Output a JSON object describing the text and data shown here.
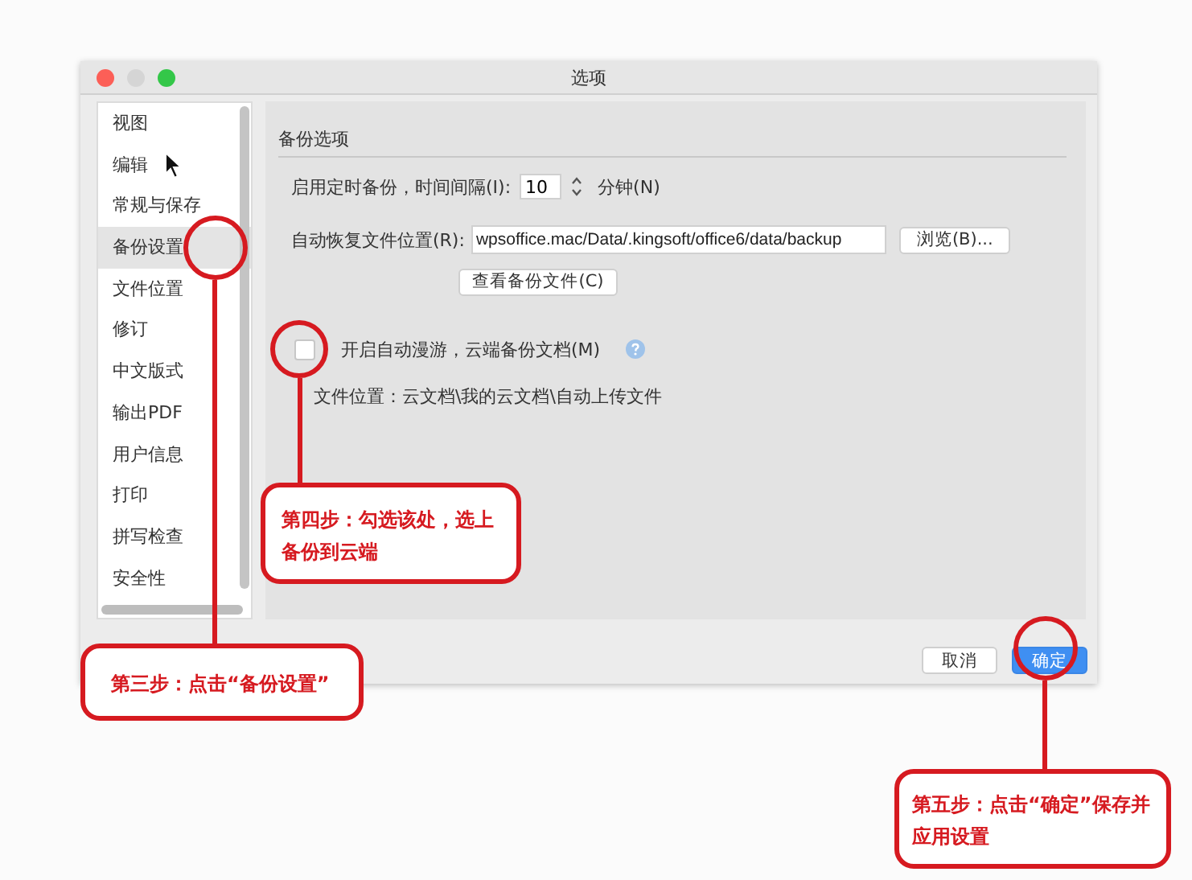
{
  "window": {
    "title": "选项"
  },
  "sidebar": {
    "items": [
      {
        "label": "视图",
        "selected": false
      },
      {
        "label": "编辑",
        "selected": false
      },
      {
        "label": "常规与保存",
        "selected": false
      },
      {
        "label": "备份设置",
        "selected": true
      },
      {
        "label": "文件位置",
        "selected": false
      },
      {
        "label": "修订",
        "selected": false
      },
      {
        "label": "中文版式",
        "selected": false
      },
      {
        "label": "输出PDF",
        "selected": false
      },
      {
        "label": "用户信息",
        "selected": false
      },
      {
        "label": "打印",
        "selected": false
      },
      {
        "label": "拼写检查",
        "selected": false
      },
      {
        "label": "安全性",
        "selected": false
      }
    ]
  },
  "panel": {
    "section_title": "备份选项",
    "timer": {
      "label": "启用定时备份，时间间隔(I):",
      "value": "10",
      "unit": "分钟(N)"
    },
    "recovery": {
      "label": "自动恢复文件位置(R):",
      "value": "wpsoffice.mac/Data/.kingsoft/office6/data/backup",
      "browse_button": "浏览(B)..."
    },
    "view_button": "查看备份文件(C)",
    "roaming": {
      "label": "开启自动漫游，云端备份文档(M)",
      "checked": false
    },
    "location": "文件位置：云文档\\我的云文档\\自动上传文件"
  },
  "buttons": [
    {
      "label": "取消",
      "kind": "default"
    },
    {
      "label": "确定",
      "kind": "primary"
    }
  ],
  "annotations": [
    {
      "text": "第四步：勾选该处，选上备份到云端"
    },
    {
      "text": "第三步：点击“备份设置”"
    },
    {
      "text": "第五步：点击“确定”保存并应用设置"
    }
  ]
}
